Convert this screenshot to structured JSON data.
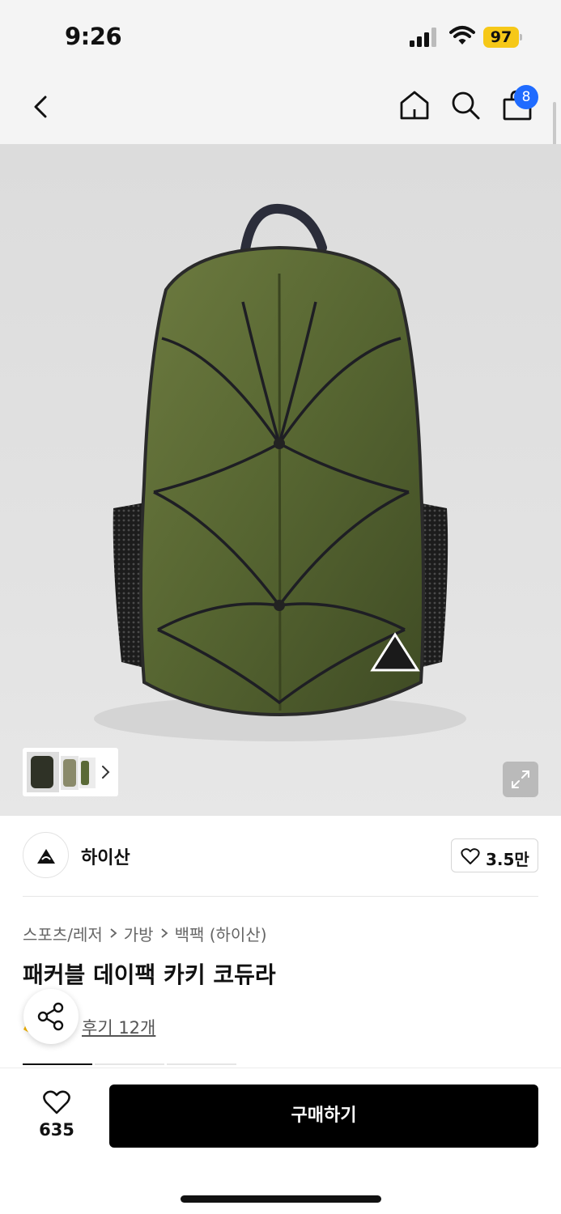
{
  "status_bar": {
    "time": "9:26",
    "battery": "97"
  },
  "nav": {
    "cart_count": "8"
  },
  "brand": {
    "name": "하이산",
    "like_count": "3.5만"
  },
  "breadcrumb": [
    "스포츠/레저",
    "가방",
    "백팩 (하이산)"
  ],
  "product": {
    "title": "패커블 데이팩 카키 코듀라",
    "review_link": "후기 12개",
    "color": "khaki"
  },
  "bottom": {
    "wish_count": "635",
    "buy_label": "구매하기"
  },
  "colors": {
    "accent_badge": "#1f6bff",
    "battery": "#f6c818",
    "buy_button": "#000000",
    "bag": "#5b6b36"
  },
  "icons": [
    "chevron-left-icon",
    "home-icon",
    "search-icon",
    "shopping-bag-icon",
    "share-icon",
    "heart-icon",
    "expand-icon",
    "chevron-right-icon"
  ]
}
